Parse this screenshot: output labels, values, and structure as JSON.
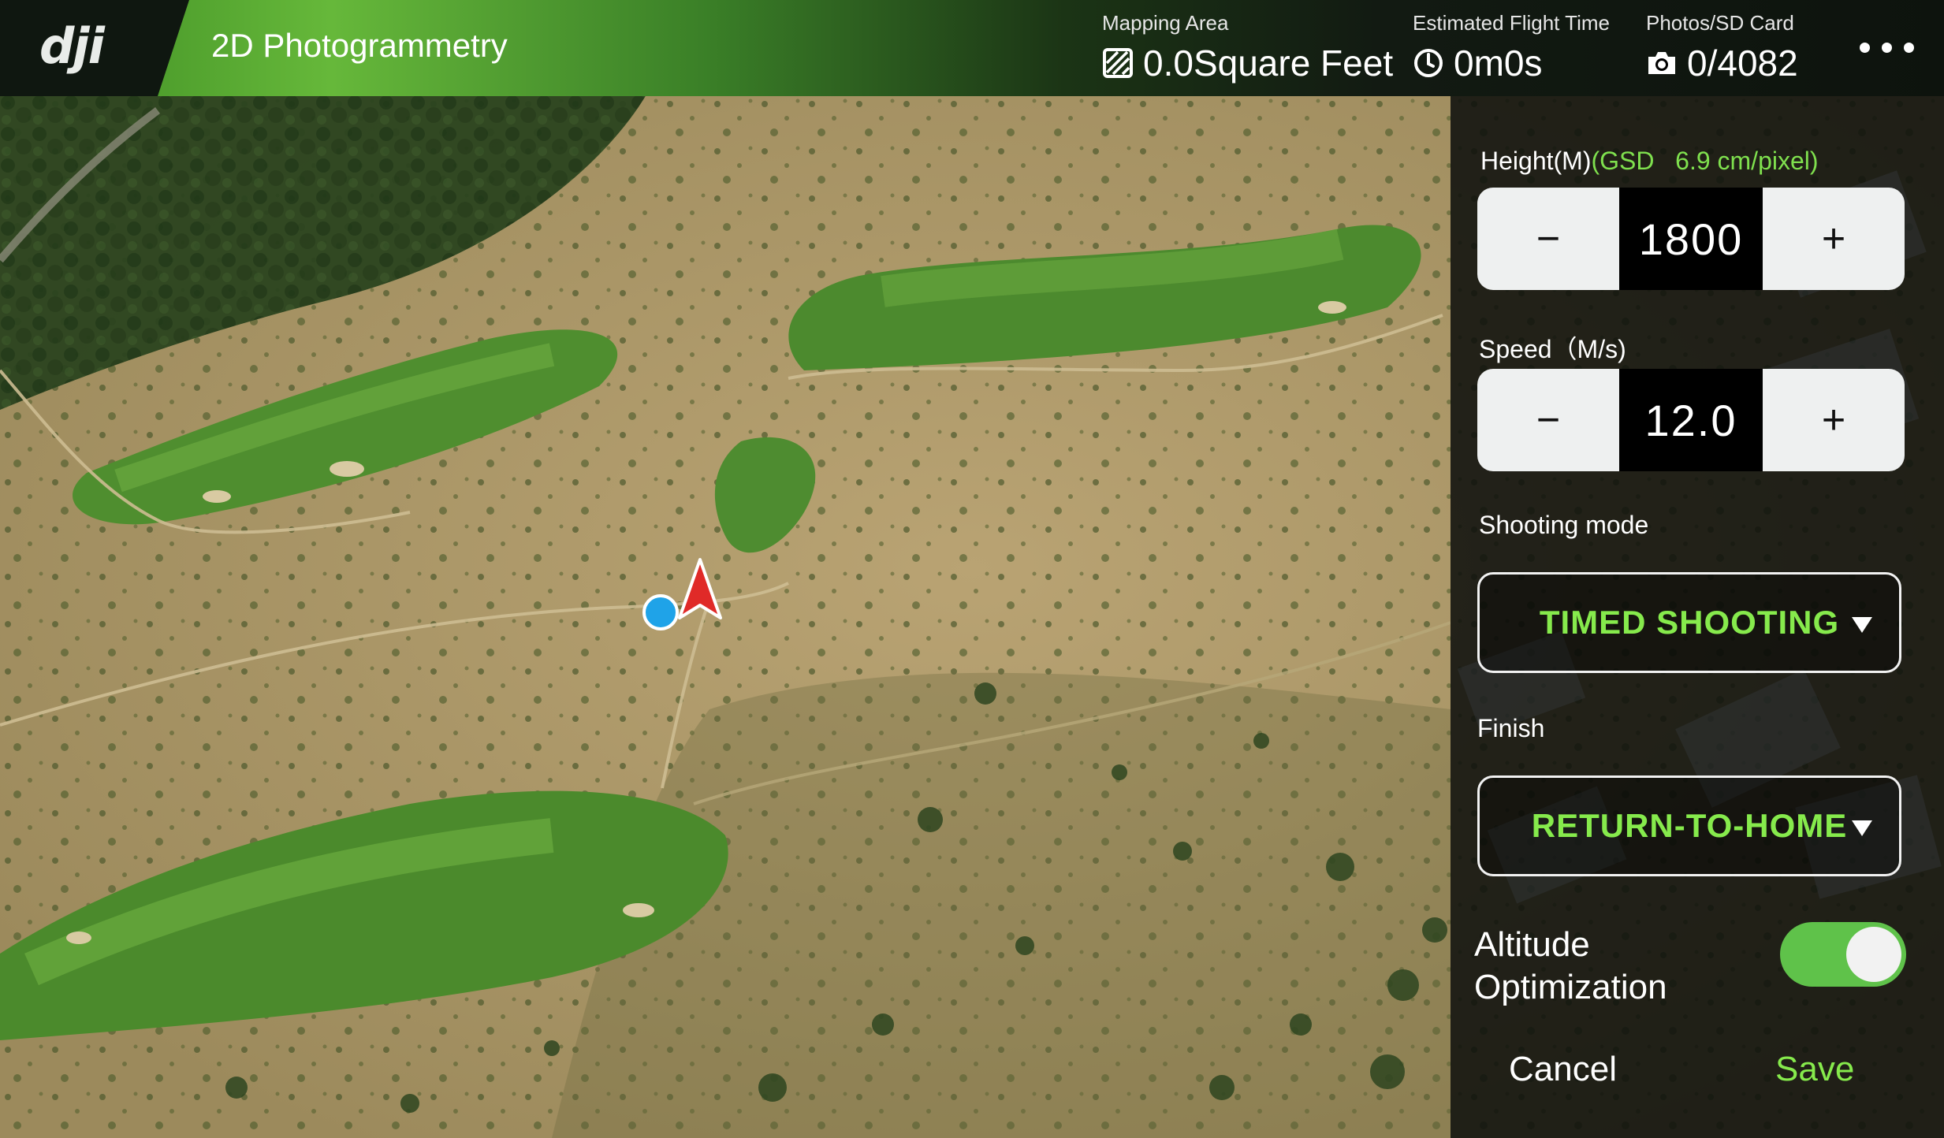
{
  "header": {
    "logo": "dji",
    "title": "2D Photogrammetry",
    "mapping_area": {
      "label": "Mapping Area",
      "value": "0.0Square Feet",
      "icon": "hatched-square-icon"
    },
    "flight_time": {
      "label": "Estimated Flight Time",
      "value": "0m0s",
      "icon": "clock-icon"
    },
    "photos": {
      "label": "Photos/SD Card",
      "value": "0/4082",
      "icon": "camera-icon"
    },
    "more_icon": "ellipsis-icon"
  },
  "panel": {
    "height": {
      "label": "Height(M)",
      "gsd_label": "(GSD",
      "gsd_value": "6.9 cm/pixel)",
      "value": "1800",
      "minus": "−",
      "plus": "+"
    },
    "speed": {
      "label": "Speed（M/s)",
      "value": "12.0",
      "minus": "−",
      "plus": "+"
    },
    "shooting_mode": {
      "label": "Shooting mode",
      "selected": "TIMED SHOOTING"
    },
    "finish": {
      "label": "Finish",
      "selected": "RETURN-TO-HOME"
    },
    "altitude_optimization": {
      "label_line1": "Altitude",
      "label_line2": "Optimization",
      "enabled": true
    },
    "cancel_label": "Cancel",
    "save_label": "Save"
  },
  "colors": {
    "accent_green": "#86ea4c",
    "toggle_on": "#5fc24a",
    "drone_marker": "#e02a28",
    "home_marker": "#1fa3e8"
  }
}
